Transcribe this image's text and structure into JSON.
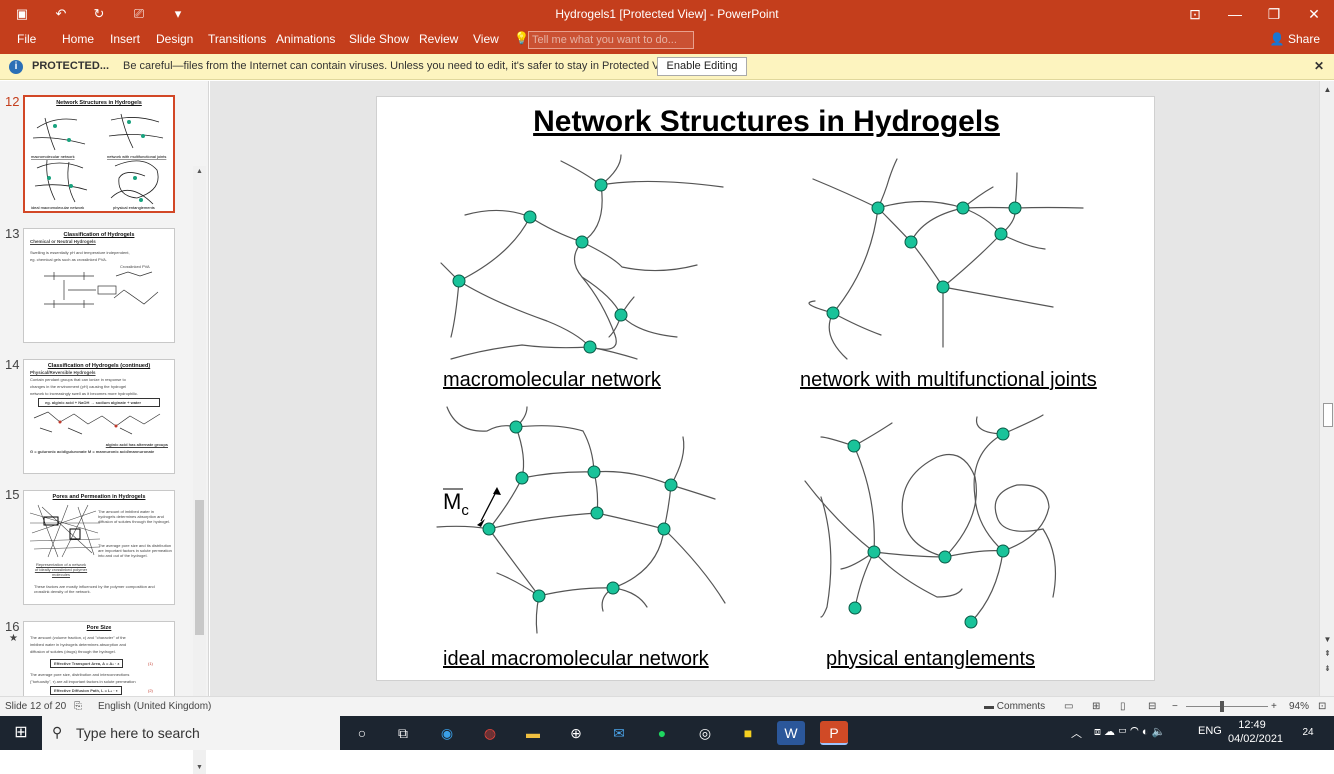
{
  "window": {
    "title": "Hydrogels1 [Protected View] - PowerPoint"
  },
  "ribbon": {
    "tabs": [
      "File",
      "Home",
      "Insert",
      "Design",
      "Transitions",
      "Animations",
      "Slide Show",
      "Review",
      "View"
    ],
    "tell_me_placeholder": "Tell me what you want to do...",
    "share_label": "Share"
  },
  "protected_bar": {
    "label": "PROTECTED...",
    "message": "Be careful—files from the Internet can contain viruses. Unless you need to edit, it's safer to stay in Protected View.",
    "button": "Enable Editing"
  },
  "thumbnails": [
    {
      "number": "12",
      "title": "Network Structures in Hydrogels",
      "captions": [
        "macromolecular network",
        "network with multifunctional joints",
        "ideal macromolecular network",
        "physical entanglements"
      ]
    },
    {
      "number": "13",
      "title": "Classification of Hydrogels",
      "subtitle": "Chemical or Neutral Hydrogels",
      "lines": [
        "Swelling is essentially pH and temperature independent,",
        "eg. chemical gels such as crosslinked PVA.",
        "Crosslinked PVA"
      ]
    },
    {
      "number": "14",
      "title": "Classification of Hydrogels (continued)",
      "subtitle": "Physical/Reversible Hydrogels",
      "lines": [
        "Contain pendant groups that can ionize in response to",
        "changes in the environment (pH) causing the hydrogel",
        "network to increasingly swell as it becomes more hydrophilic.",
        "eg. alginic acid + NaOH → sodium alginate + water",
        "alginic acid has alternate groups",
        "G = guluronic acid/guluronate   M = mannuronic acid/mannuronate"
      ]
    },
    {
      "number": "15",
      "title": "Pores and Permeation in Hydrogels",
      "lines": [
        "The amount of imbibed water in hydrogels determines absorption and diffusion of solutes through the hydrogel.",
        "The average pore size and its distribution are important factors in solute permeation into and out of the hydrogel.",
        "These factors are mostly influenced by the polymer composition and crosslink density of the network.",
        "Representation of a network of ideally crosslinked polymer molecules"
      ]
    },
    {
      "number": "16",
      "star": "★",
      "title": "Pore Size",
      "lines": [
        "The amount (volume fraction, ε) and \"character\" of the",
        "imbibed water in hydrogels determines absorption and",
        "diffusion of solutes (drugs) through the hydrogel.",
        "Effective Transport Area, A = A₀ · ε",
        "(1)",
        "The average pore size, distribution and interconnections",
        "(\"tortuosity\", τ) are all important factors in solute permeation",
        "Effective Diffusion Path, L = L₀ · τ",
        "(2)"
      ]
    }
  ],
  "slide": {
    "title": "Network Structures in Hydrogels",
    "captions": {
      "top_left": "macromolecular network",
      "top_right": "network with multifunctional joints",
      "bottom_left": "ideal macromolecular network",
      "bottom_right": "physical entanglements"
    },
    "mc_label_main": "M",
    "mc_label_sub": "c"
  },
  "status": {
    "slide_info": "Slide 12 of 20",
    "language": "English (United Kingdom)",
    "comments": "Comments",
    "zoom": "94%"
  },
  "taskbar": {
    "search_placeholder": "Type here to search",
    "lang": "ENG",
    "time": "12:49",
    "date": "04/02/2021",
    "notifications": "24"
  },
  "colors": {
    "accent": "#c43e1c",
    "node_fill": "#19c39a",
    "protected_bg": "#fdf4bf"
  }
}
